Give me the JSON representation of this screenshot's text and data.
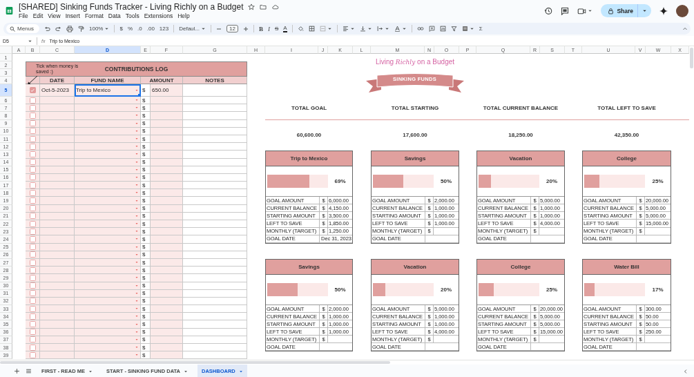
{
  "document": {
    "title": "[SHARED] Sinking Funds Tracker - Living Richly on a Budget",
    "menus": [
      "File",
      "Edit",
      "View",
      "Insert",
      "Format",
      "Data",
      "Tools",
      "Extensions",
      "Help"
    ],
    "share_label": "Share"
  },
  "toolbar": {
    "search_placeholder": "Menus",
    "zoom": "100%",
    "currency": "$",
    "percent": "%",
    "decrease_decimals": ".0",
    "increase_decimals": ".00",
    "number_format": "123",
    "font": "Defaul...",
    "font_size": "12",
    "bold": "B",
    "italic": "I",
    "strikethrough": "S",
    "text_color": "A",
    "sum": "Σ"
  },
  "formula_bar": {
    "cell_ref": "D5",
    "fx": "fx",
    "value": "Trip to Mexico"
  },
  "columns": [
    {
      "label": "A",
      "selected": false
    },
    {
      "label": "B",
      "selected": false
    },
    {
      "label": "C",
      "selected": false
    },
    {
      "label": "D",
      "selected": true
    },
    {
      "label": "E",
      "selected": false
    },
    {
      "label": "F",
      "selected": false
    },
    {
      "label": "G",
      "selected": false
    },
    {
      "label": "H",
      "selected": false
    },
    {
      "label": "I",
      "selected": false
    },
    {
      "label": "J",
      "selected": false
    },
    {
      "label": "K",
      "selected": false
    },
    {
      "label": "L",
      "selected": false
    },
    {
      "label": "M",
      "selected": false
    },
    {
      "label": "N",
      "selected": false
    },
    {
      "label": "O",
      "selected": false
    },
    {
      "label": "P",
      "selected": false
    },
    {
      "label": "Q",
      "selected": false
    },
    {
      "label": "R",
      "selected": false
    },
    {
      "label": "S",
      "selected": false
    },
    {
      "label": "T",
      "selected": false
    },
    {
      "label": "U",
      "selected": false
    },
    {
      "label": "V",
      "selected": false
    },
    {
      "label": "W",
      "selected": false
    },
    {
      "label": "X",
      "selected": false
    }
  ],
  "row_numbers": [
    {
      "label": "1",
      "selected": false
    },
    {
      "label": "2",
      "selected": false
    },
    {
      "label": "3",
      "selected": false
    },
    {
      "label": "4",
      "selected": false
    },
    {
      "label": "5",
      "selected": true
    },
    {
      "label": "6",
      "selected": false
    },
    {
      "label": "7",
      "selected": false
    },
    {
      "label": "8",
      "selected": false
    },
    {
      "label": "9",
      "selected": false
    },
    {
      "label": "10",
      "selected": false
    },
    {
      "label": "11",
      "selected": false
    },
    {
      "label": "12",
      "selected": false
    },
    {
      "label": "13",
      "selected": false
    },
    {
      "label": "14",
      "selected": false
    },
    {
      "label": "15",
      "selected": false
    },
    {
      "label": "16",
      "selected": false
    },
    {
      "label": "17",
      "selected": false
    },
    {
      "label": "18",
      "selected": false
    },
    {
      "label": "19",
      "selected": false
    },
    {
      "label": "20",
      "selected": false
    },
    {
      "label": "21",
      "selected": false
    },
    {
      "label": "22",
      "selected": false
    },
    {
      "label": "23",
      "selected": false
    },
    {
      "label": "24",
      "selected": false
    },
    {
      "label": "25",
      "selected": false
    },
    {
      "label": "26",
      "selected": false
    },
    {
      "label": "27",
      "selected": false
    },
    {
      "label": "28",
      "selected": false
    },
    {
      "label": "29",
      "selected": false
    },
    {
      "label": "30",
      "selected": false
    },
    {
      "label": "31",
      "selected": false
    },
    {
      "label": "32",
      "selected": false
    },
    {
      "label": "33",
      "selected": false
    },
    {
      "label": "34",
      "selected": false
    },
    {
      "label": "35",
      "selected": false
    },
    {
      "label": "36",
      "selected": false
    },
    {
      "label": "37",
      "selected": false
    },
    {
      "label": "38",
      "selected": false
    },
    {
      "label": "39",
      "selected": false
    }
  ],
  "contributions_log": {
    "title": "CONTRIBUTIONS LOG",
    "hint": "Tick when money is saved :)",
    "headers": [
      "DATE",
      "FUND NAME",
      "AMOUNT",
      "NOTES"
    ],
    "rows": [
      {
        "checked": true,
        "date": "Oct-5-2023",
        "fund": "Trip to Mexico",
        "currency": "$",
        "amount": "650.00",
        "selected": true
      },
      {
        "checked": false,
        "currency": "$",
        "selected": false
      },
      {
        "checked": false,
        "currency": "$",
        "selected": false
      },
      {
        "checked": false,
        "currency": "$",
        "selected": false
      },
      {
        "checked": false,
        "currency": "$",
        "selected": false
      },
      {
        "checked": false,
        "currency": "$",
        "selected": false
      },
      {
        "checked": false,
        "currency": "$",
        "selected": false
      },
      {
        "checked": false,
        "currency": "$",
        "selected": false
      },
      {
        "checked": false,
        "currency": "$",
        "selected": false
      },
      {
        "checked": false,
        "currency": "$",
        "selected": false
      },
      {
        "checked": false,
        "currency": "$",
        "selected": false
      },
      {
        "checked": false,
        "currency": "$",
        "selected": false
      },
      {
        "checked": false,
        "currency": "$",
        "selected": false
      },
      {
        "checked": false,
        "currency": "$",
        "selected": false
      },
      {
        "checked": false,
        "currency": "$",
        "selected": false
      },
      {
        "checked": false,
        "currency": "$",
        "selected": false
      },
      {
        "checked": false,
        "currency": "$",
        "selected": false
      },
      {
        "checked": false,
        "currency": "$",
        "selected": false
      },
      {
        "checked": false,
        "currency": "$",
        "selected": false
      },
      {
        "checked": false,
        "currency": "$",
        "selected": false
      },
      {
        "checked": false,
        "currency": "$",
        "selected": false
      },
      {
        "checked": false,
        "currency": "$",
        "selected": false
      },
      {
        "checked": false,
        "currency": "$",
        "selected": false
      },
      {
        "checked": false,
        "currency": "$",
        "selected": false
      },
      {
        "checked": false,
        "currency": "$",
        "selected": false
      },
      {
        "checked": false,
        "currency": "$",
        "selected": false
      },
      {
        "checked": false,
        "currency": "$",
        "selected": false
      },
      {
        "checked": false,
        "currency": "$",
        "selected": false
      },
      {
        "checked": false,
        "currency": "$",
        "selected": false
      },
      {
        "checked": false,
        "currency": "$",
        "selected": false
      },
      {
        "checked": false,
        "currency": "$",
        "selected": false
      },
      {
        "checked": false,
        "currency": "$",
        "selected": false
      },
      {
        "checked": false,
        "currency": "$",
        "selected": false
      },
      {
        "checked": false,
        "currency": "$",
        "selected": false
      },
      {
        "checked": false,
        "currency": "$",
        "selected": false
      }
    ]
  },
  "dashboard": {
    "logo": "Living *Richly* on a Budget",
    "banner": "SINKING FUNDS",
    "totals": [
      {
        "label": "TOTAL GOAL",
        "value": "60,600.00"
      },
      {
        "label": "TOTAL STARTING",
        "value": "17,600.00"
      },
      {
        "label": "TOTAL CURRENT BALANCE",
        "value": "18,250.00"
      },
      {
        "label": "TOTAL LEFT TO SAVE",
        "value": "42,350.00"
      }
    ],
    "funds": [
      {
        "name": "Trip to Mexico",
        "level": 0.69,
        "percent": "69%",
        "rows": [
          {
            "label": "GOAL AMOUNT",
            "currency": "$",
            "value": "6,000.00"
          },
          {
            "label": "CURRENT BALANCE",
            "currency": "$",
            "value": "4,150.00"
          },
          {
            "label": "STARTING AMOUNT",
            "currency": "$",
            "value": "3,500.00"
          },
          {
            "label": "LEFT TO SAVE",
            "currency": "$",
            "value": "1,850.00"
          },
          {
            "label": "MONTHLY (TARGET)",
            "currency": "$",
            "value": "1,250.00"
          },
          {
            "label": "GOAL DATE",
            "value": "Dec 31, 2023"
          }
        ]
      },
      {
        "name": "Savings",
        "level": 0.5,
        "percent": "50%",
        "rows": [
          {
            "label": "GOAL AMOUNT",
            "currency": "$",
            "value": "2,000.00"
          },
          {
            "label": "CURRENT BALANCE",
            "currency": "$",
            "value": "1,000.00"
          },
          {
            "label": "STARTING AMOUNT",
            "currency": "$",
            "value": "1,000.00"
          },
          {
            "label": "LEFT TO SAVE",
            "currency": "$",
            "value": "1,000.00"
          },
          {
            "label": "MONTHLY (TARGET)",
            "currency": "$"
          },
          {
            "label": "GOAL DATE"
          }
        ]
      },
      {
        "name": "Vacation",
        "level": 0.2,
        "percent": "20%",
        "rows": [
          {
            "label": "GOAL AMOUNT",
            "currency": "$",
            "value": "5,000.00"
          },
          {
            "label": "CURRENT BALANCE",
            "currency": "$",
            "value": "1,000.00"
          },
          {
            "label": "STARTING AMOUNT",
            "currency": "$",
            "value": "1,000.00"
          },
          {
            "label": "LEFT TO SAVE",
            "currency": "$",
            "value": "4,000.00"
          },
          {
            "label": "MONTHLY (TARGET)",
            "currency": "$"
          },
          {
            "label": "GOAL DATE"
          }
        ]
      },
      {
        "name": "College",
        "level": 0.25,
        "percent": "25%",
        "rows": [
          {
            "label": "GOAL AMOUNT",
            "currency": "$",
            "value": "20,000.00"
          },
          {
            "label": "CURRENT BALANCE",
            "currency": "$",
            "value": "5,000.00"
          },
          {
            "label": "STARTING AMOUNT",
            "currency": "$",
            "value": "5,000.00"
          },
          {
            "label": "LEFT TO SAVE",
            "currency": "$",
            "value": "15,000.00"
          },
          {
            "label": "MONTHLY (TARGET)",
            "currency": "$"
          },
          {
            "label": "GOAL DATE"
          }
        ]
      },
      {
        "name": "Savings",
        "level": 0.5,
        "percent": "50%",
        "rows": [
          {
            "label": "GOAL AMOUNT",
            "currency": "$",
            "value": "2,000.00"
          },
          {
            "label": "CURRENT BALANCE",
            "currency": "$",
            "value": "1,000.00"
          },
          {
            "label": "STARTING AMOUNT",
            "currency": "$",
            "value": "1,000.00"
          },
          {
            "label": "LEFT TO SAVE",
            "currency": "$",
            "value": "1,000.00"
          },
          {
            "label": "MONTHLY (TARGET)",
            "currency": "$"
          },
          {
            "label": "GOAL DATE"
          }
        ]
      },
      {
        "name": "Vacation",
        "level": 0.2,
        "percent": "20%",
        "rows": [
          {
            "label": "GOAL AMOUNT",
            "currency": "$",
            "value": "5,000.00"
          },
          {
            "label": "CURRENT BALANCE",
            "currency": "$",
            "value": "1,000.00"
          },
          {
            "label": "STARTING AMOUNT",
            "currency": "$",
            "value": "1,000.00"
          },
          {
            "label": "LEFT TO SAVE",
            "currency": "$",
            "value": "4,000.00"
          },
          {
            "label": "MONTHLY (TARGET)",
            "currency": "$"
          },
          {
            "label": "GOAL DATE"
          }
        ]
      },
      {
        "name": "College",
        "level": 0.25,
        "percent": "25%",
        "rows": [
          {
            "label": "GOAL AMOUNT",
            "currency": "$",
            "value": "20,000.00"
          },
          {
            "label": "CURRENT BALANCE",
            "currency": "$",
            "value": "5,000.00"
          },
          {
            "label": "STARTING AMOUNT",
            "currency": "$",
            "value": "5,000.00"
          },
          {
            "label": "LEFT TO SAVE",
            "currency": "$",
            "value": "15,000.00"
          },
          {
            "label": "MONTHLY (TARGET)",
            "currency": "$"
          },
          {
            "label": "GOAL DATE"
          }
        ]
      },
      {
        "name": "Water Bill",
        "level": 0.17,
        "percent": "17%",
        "rows": [
          {
            "label": "GOAL AMOUNT",
            "currency": "$",
            "value": "300.00"
          },
          {
            "label": "CURRENT BALANCE",
            "currency": "$",
            "value": "50.00"
          },
          {
            "label": "STARTING AMOUNT",
            "currency": "$",
            "value": "50.00"
          },
          {
            "label": "LEFT TO SAVE",
            "currency": "$",
            "value": "250.00"
          },
          {
            "label": "MONTHLY (TARGET)",
            "currency": "$"
          },
          {
            "label": "GOAL DATE"
          }
        ]
      }
    ]
  },
  "sheet_tabs": [
    {
      "label": "FIRST - READ ME",
      "selected": false
    },
    {
      "label": "START - SINKING FUND DATA",
      "selected": false
    },
    {
      "label": "DASHBOARD",
      "selected": true
    }
  ]
}
